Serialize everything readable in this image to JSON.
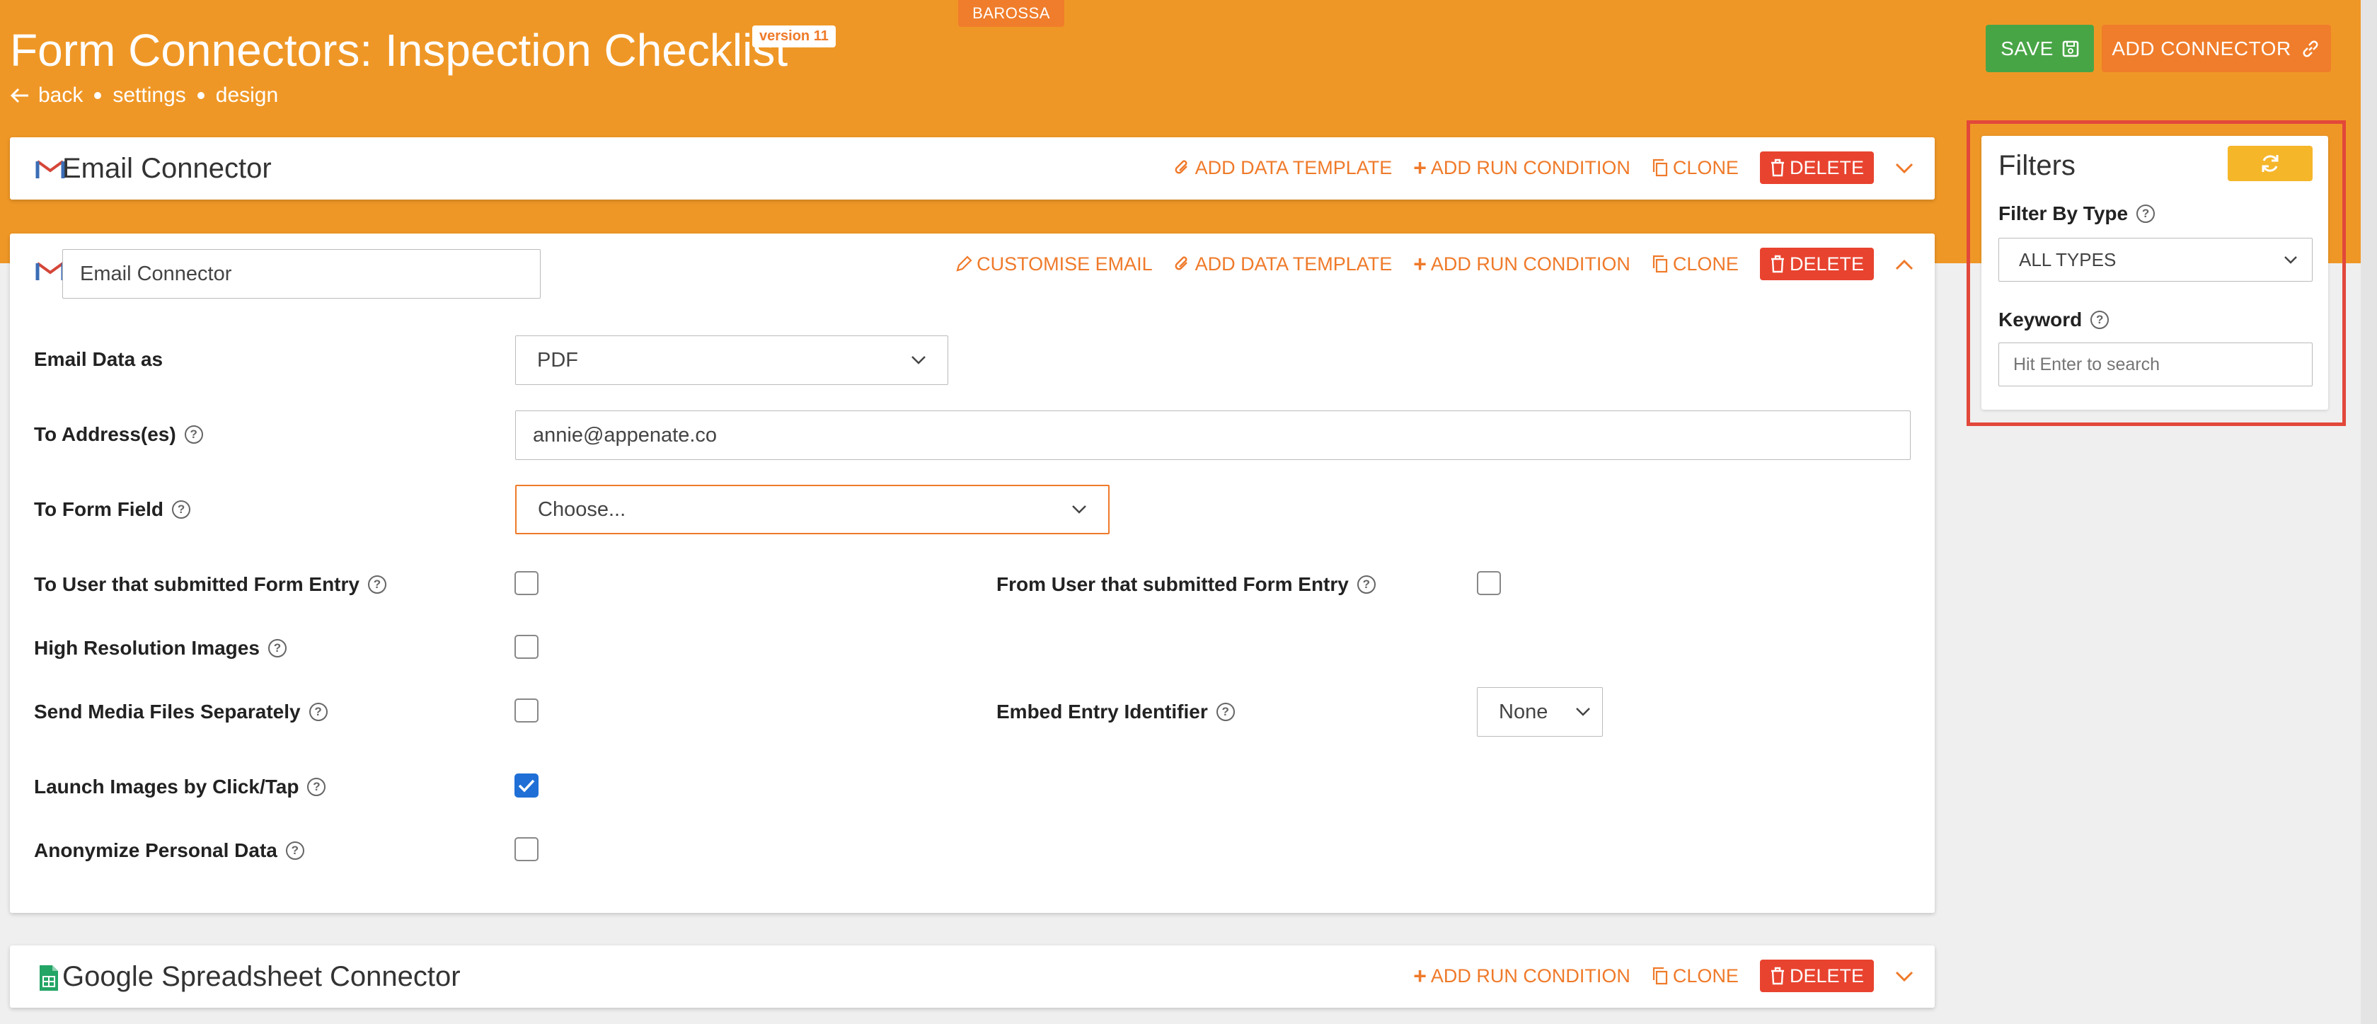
{
  "env_tag": "BAROSSA",
  "header": {
    "title": "Form Connectors: Inspection Checklist",
    "version": "version 11",
    "nav": {
      "back": "back",
      "settings": "settings",
      "design": "design"
    },
    "save_label": "SAVE",
    "add_connector_label": "ADD CONNECTOR"
  },
  "connectors": [
    {
      "title": "Email Connector",
      "icon": "gmail-icon",
      "actions": {
        "add_data_template": "ADD DATA TEMPLATE",
        "add_run_condition": "ADD RUN CONDITION",
        "clone": "CLONE",
        "delete": "DELETE"
      }
    },
    {
      "name_value": "Email Connector",
      "icon": "gmail-icon",
      "actions": {
        "customise_email": "CUSTOMISE EMAIL",
        "add_data_template": "ADD DATA TEMPLATE",
        "add_run_condition": "ADD RUN CONDITION",
        "clone": "CLONE",
        "delete": "DELETE"
      },
      "fields": {
        "email_data_as": {
          "label": "Email Data as",
          "value": "PDF"
        },
        "to_addresses": {
          "label": "To Address(es)",
          "value": "annie@appenate.co"
        },
        "to_form_field": {
          "label": "To Form Field",
          "value": "Choose..."
        },
        "to_user_submitted": {
          "label": "To User that submitted Form Entry",
          "checked": false
        },
        "from_user_submitted": {
          "label": "From User that submitted Form Entry",
          "checked": false
        },
        "high_res_images": {
          "label": "High Resolution Images",
          "checked": false
        },
        "send_media_separately": {
          "label": "Send Media Files Separately",
          "checked": false
        },
        "embed_entry_identifier": {
          "label": "Embed Entry Identifier",
          "value": "None"
        },
        "launch_images": {
          "label": "Launch Images by Click/Tap",
          "checked": true
        },
        "anonymize": {
          "label": "Anonymize Personal Data",
          "checked": false
        }
      }
    },
    {
      "title": "Google Spreadsheet Connector",
      "icon": "google-sheets-icon",
      "actions": {
        "add_run_condition": "ADD RUN CONDITION",
        "clone": "CLONE",
        "delete": "DELETE"
      }
    }
  ],
  "filters": {
    "title": "Filters",
    "filter_by_type_label": "Filter By Type",
    "filter_by_type_value": "ALL TYPES",
    "keyword_label": "Keyword",
    "keyword_placeholder": "Hit Enter to search"
  },
  "colors": {
    "header_orange": "#ef9726",
    "action_orange": "#ef7a2a",
    "save_green": "#48a546",
    "delete_red": "#e8432f",
    "refresh_yellow": "#f5b62a",
    "highlight_red": "#e2483a",
    "checkbox_blue": "#1f6fd6"
  }
}
